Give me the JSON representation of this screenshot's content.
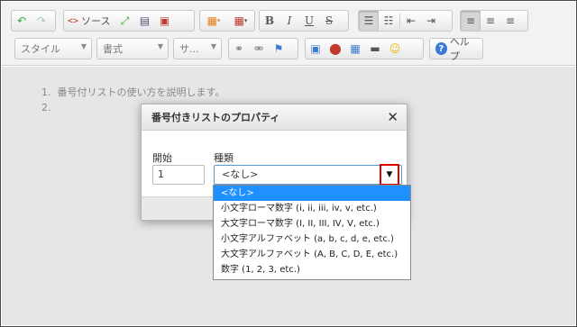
{
  "toolbar": {
    "source_label": "ソース",
    "style_combo": "スタイル",
    "format_combo": "書式",
    "size_combo": "サ...",
    "help_label": "ヘルプ"
  },
  "document": {
    "items": [
      {
        "number": "1.",
        "text": "番号付リストの使い方を説明します。"
      },
      {
        "number": "2.",
        "text": ""
      }
    ]
  },
  "dialog": {
    "title": "番号付きリストのプロパティ",
    "close": "✕",
    "start_label": "開始",
    "start_value": "1",
    "type_label": "種類",
    "type_value": "<なし>"
  },
  "dropdown": {
    "options": [
      "<なし>",
      "小文字ローマ数字 (i, ii, iii, iv, v, etc.)",
      "大文字ローマ数字 (I, II, III, IV, V, etc.)",
      "小文字アルファベット (a, b, c, d, e, etc.)",
      "大文字アルファベット (A, B, C, D, E, etc.)",
      "数字 (1, 2, 3, etc.)"
    ],
    "selected": "<なし>"
  },
  "colors": {
    "highlight": "#1e90ff",
    "callout_border": "#dd0000"
  }
}
